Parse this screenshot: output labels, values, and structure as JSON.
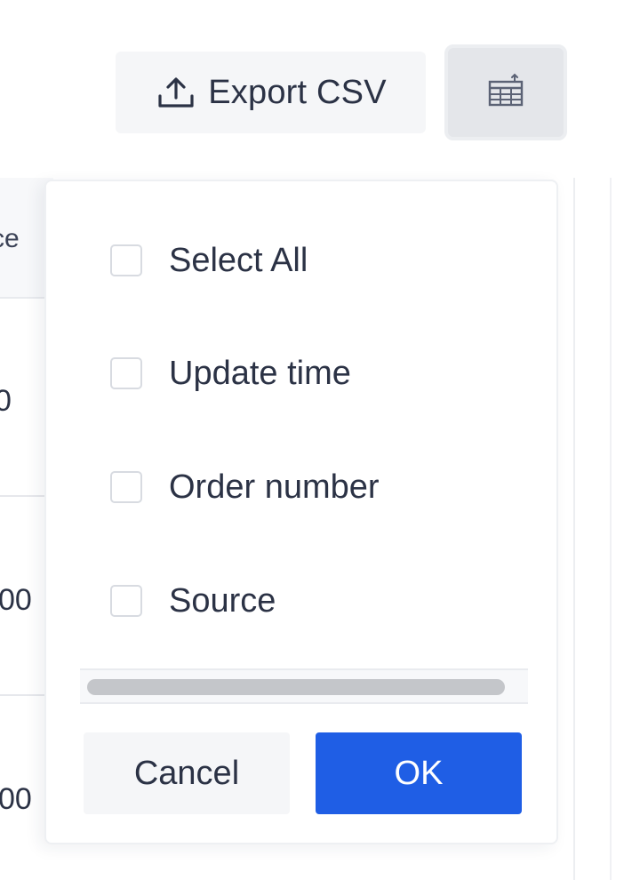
{
  "toolbar": {
    "export_label": "Export CSV",
    "export_icon": "upload-icon",
    "columns_icon": "table-columns-icon"
  },
  "table": {
    "header_partial": "ce",
    "rows_partial": [
      "0",
      "00",
      "00"
    ]
  },
  "column_picker": {
    "options": [
      {
        "label": "Select All",
        "checked": false
      },
      {
        "label": "Update time",
        "checked": false
      },
      {
        "label": "Order number",
        "checked": false
      },
      {
        "label": "Source",
        "checked": false
      }
    ],
    "cancel_label": "Cancel",
    "ok_label": "OK"
  },
  "colors": {
    "primary": "#1f5ee5",
    "button_bg": "#f5f6f8",
    "text": "#2b3245"
  }
}
